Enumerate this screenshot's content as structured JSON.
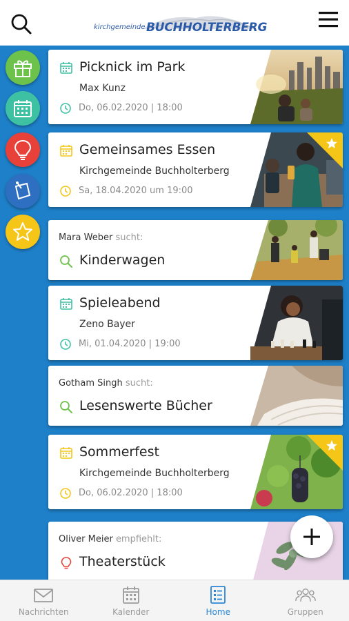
{
  "header": {
    "logo_small": "kirchgemeinde",
    "logo_big": "BUCHHOLTERBERG",
    "search_icon": "search-icon",
    "menu_icon": "hamburger-menu-icon"
  },
  "sidebar": {
    "items": [
      {
        "name": "gift",
        "icon": "gift-icon",
        "color": "#6cc24a"
      },
      {
        "name": "calendar",
        "icon": "calendar-icon",
        "color": "#3ec1a3"
      },
      {
        "name": "idea",
        "icon": "lightbulb-icon",
        "color": "#e8413a"
      },
      {
        "name": "search-offer",
        "icon": "sticky-note-icon",
        "color": "#2e6fc1"
      },
      {
        "name": "favorites",
        "icon": "star-icon",
        "color": "#f5c518"
      }
    ]
  },
  "cards": [
    {
      "type": "event",
      "title": "Picknick im Park",
      "subtitle": "Max Kunz",
      "date": "Do, 06.02.2020 | 18:00",
      "accent": "#3ec1a3",
      "featured": false
    },
    {
      "type": "event",
      "title": "Gemeinsames Essen",
      "subtitle": "Kirchgemeinde Buchholterberg",
      "date": "Sa, 18.04.2020 um 19:00",
      "accent": "#f5c518",
      "featured": true
    },
    {
      "type": "search",
      "person": "Mara Weber",
      "verb": "sucht:",
      "title": "Kinderwagen",
      "accent": "#6cc24a"
    },
    {
      "type": "event",
      "title": "Spieleabend",
      "subtitle": "Zeno Bayer",
      "date": "Mi, 01.04.2020 | 19:00",
      "accent": "#3ec1a3",
      "featured": false
    },
    {
      "type": "search",
      "person": "Gotham Singh",
      "verb": "sucht:",
      "title": "Lesenswerte Bücher",
      "accent": "#6cc24a"
    },
    {
      "type": "event",
      "title": "Sommerfest",
      "subtitle": "Kirchgemeinde Buchholterberg",
      "date": "Do, 06.02.2020 | 18:00",
      "accent": "#f5c518",
      "featured": true
    },
    {
      "type": "recommend",
      "person": "Oliver Meier",
      "verb": "empfiehlt:",
      "title": "Theaterstück",
      "accent": "#e8413a"
    }
  ],
  "fab": {
    "icon": "plus-icon"
  },
  "tabbar": {
    "tabs": [
      {
        "label": "Nachrichten",
        "icon": "envelope-icon",
        "active": false
      },
      {
        "label": "Kalender",
        "icon": "calendar-icon",
        "active": false
      },
      {
        "label": "Home",
        "icon": "list-icon",
        "active": true
      },
      {
        "label": "Gruppen",
        "icon": "group-icon",
        "active": false
      }
    ]
  },
  "colors": {
    "primary_blue": "#1e80c9",
    "active_tab": "#2a86d6"
  }
}
